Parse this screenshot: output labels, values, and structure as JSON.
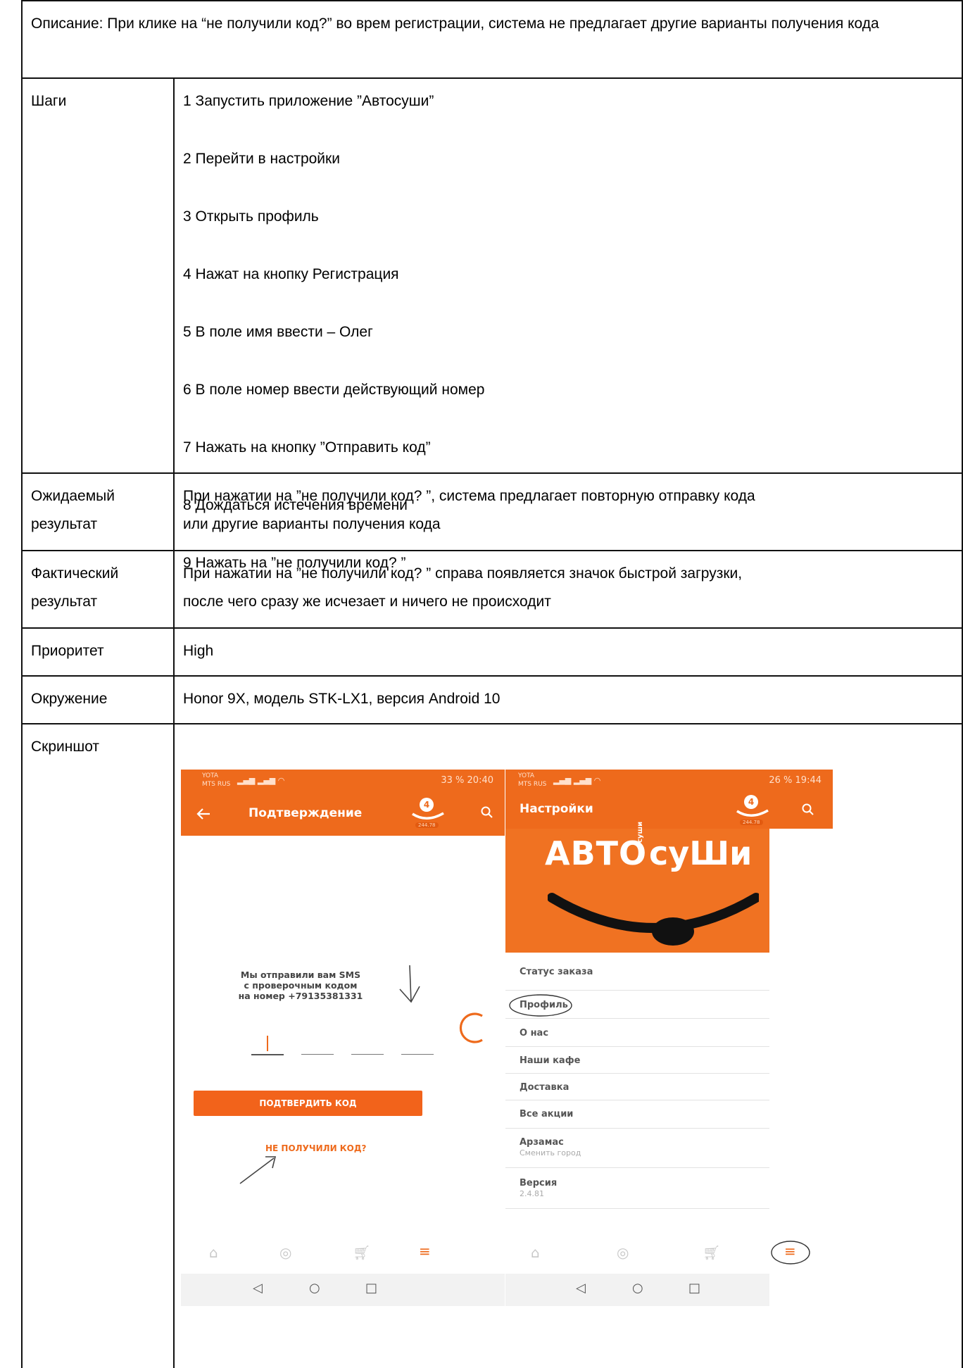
{
  "description": "Описание: При клике на “не получили код?” во врем регистрации, система не предлагает другие варианты получения кода",
  "rows": {
    "steps": {
      "label": "Шаги",
      "items": [
        "1 Запустить приложение  ”Автосуши”",
        "2 Перейти в настройки",
        "3 Открыть профиль",
        "4 Нажат на кнопку Регистрация",
        "5 В поле имя ввести – Олег",
        "6 В поле номер ввести действующий номер",
        "7 Нажать на кнопку  ”Отправить код”",
        "8 Дождаться истечения времени",
        "9 Нажать на ”не получили код? ”"
      ]
    },
    "expected": {
      "label_1": "Ожидаемый",
      "label_2": "результат",
      "line_1": "При нажатии на ”не получили код? ”, система предлагает повторную отправку кода",
      "line_2": "или  другие варианты получения кода"
    },
    "actual": {
      "label_1": "Фактический",
      "label_2": "результат",
      "line_1": "При нажатии на ”не получили код? ” справа появляется значок быстрой загрузки,",
      "line_2": "после чего сразу же исчезает и ничего не происходит"
    },
    "priority": {
      "label": "Приоритет",
      "value": "High"
    },
    "environment": {
      "label": "Окружение",
      "value": "Honor 9X, модель STK-LX1, версия Android 10"
    },
    "screenshot": {
      "label": "Скриншот"
    }
  },
  "phone1": {
    "status_left_1": "YOTA",
    "status_left_2": "MTS RUS",
    "status_right": "33 %  20:40",
    "back_icon": "arrow-left",
    "title": "Подтверждение",
    "badge": "4",
    "badge_sub": "244.78",
    "message_1": "Мы отправили вам SMS",
    "message_2": "с проверочным кодом",
    "message_3": "на номер +79135381331",
    "confirm_button": "ПОДТВЕРДИТЬ КОД",
    "no_code_link": "НЕ ПОЛУЧИЛИ КОД?"
  },
  "phone2": {
    "status_left_1": "YOTA",
    "status_left_2": "MTS RUS",
    "status_right": "26 %  19:44",
    "title": "Настройки",
    "badge": "4",
    "badge_sub": "244.78",
    "banner_left": "АВТО",
    "banner_vertical": "суши",
    "banner_right": "суШи",
    "menu": [
      {
        "label": "Статус заказа"
      },
      {
        "label": "Профиль"
      },
      {
        "label": "О нас"
      },
      {
        "label": "Наши кафе"
      },
      {
        "label": "Доставка"
      },
      {
        "label": "Все акции"
      },
      {
        "label": "Арзамас",
        "sub": "Сменить город"
      },
      {
        "label": "Версия",
        "sub": "2.4.81"
      }
    ]
  },
  "colors": {
    "brand_orange": "#ee6a1c",
    "button_orange": "#f2631b"
  }
}
